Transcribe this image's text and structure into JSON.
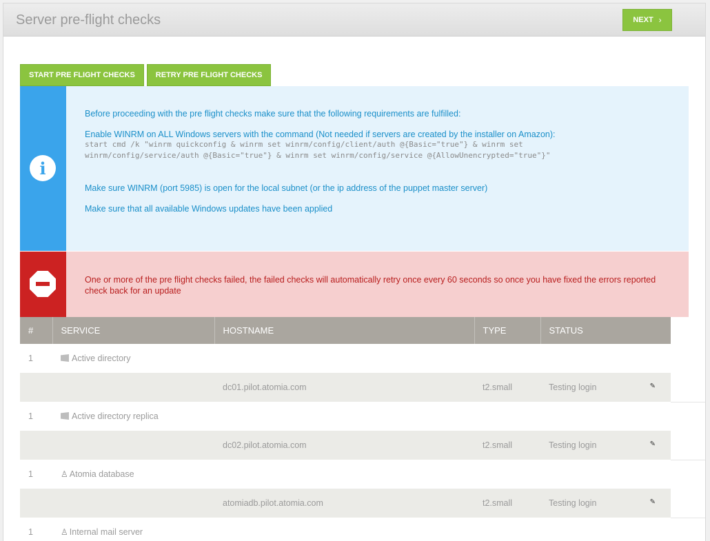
{
  "header": {
    "title": "Server pre-flight checks",
    "next_label": "NEXT",
    "next_icon": "chevron-right"
  },
  "actions": {
    "start_label": "START PRE FLIGHT CHECKS",
    "retry_label": "RETRY PRE FLIGHT CHECKS"
  },
  "info": {
    "icon": "info-icon",
    "intro": "Before proceeding with the pre flight checks make sure that the following requirements are fulfilled:",
    "winrm_text": "Enable WINRM on ALL Windows servers with the command (Not needed if servers are created by the installer on Amazon):",
    "command_line1": "start cmd /k \"winrm quickconfig & winrm set winrm/config/client/auth @{Basic=\"true\"} & winrm set",
    "command_line2": "winrm/config/service/auth @{Basic=\"true\"} & winrm set winrm/config/service @{AllowUnencrypted=\"true\"}\"",
    "port_text": "Make sure WINRM (port 5985) is open for the local subnet (or the ip address of the puppet master server)",
    "updates_text": "Make sure that all available Windows updates have been applied"
  },
  "error": {
    "icon": "stop-icon",
    "message": "One or more of the pre flight checks failed, the failed checks will automatically retry once every 60 seconds so once you have fixed the errors reported check back for an update"
  },
  "table": {
    "columns": [
      "#",
      "SERVICE",
      "HOSTNAME",
      "TYPE",
      "STATUS"
    ],
    "rows": [
      {
        "num": "1",
        "service": "Active directory",
        "os": "windows",
        "hostname": "dc01.pilot.atomia.com",
        "type": "t2.small",
        "status": "Testing login"
      },
      {
        "num": "1",
        "service": "Active directory replica",
        "os": "windows",
        "hostname": "dc02.pilot.atomia.com",
        "type": "t2.small",
        "status": "Testing login"
      },
      {
        "num": "1",
        "service": "Atomia database",
        "os": "linux",
        "hostname": "atomiadb.pilot.atomia.com",
        "type": "t2.small",
        "status": "Testing login"
      },
      {
        "num": "1",
        "service": "Internal mail server",
        "os": "linux"
      }
    ]
  },
  "colors": {
    "accent_green": "#8bc43f",
    "info_blue": "#3aa4eb",
    "error_red": "#cc2222",
    "table_header": "#aaa69f"
  }
}
